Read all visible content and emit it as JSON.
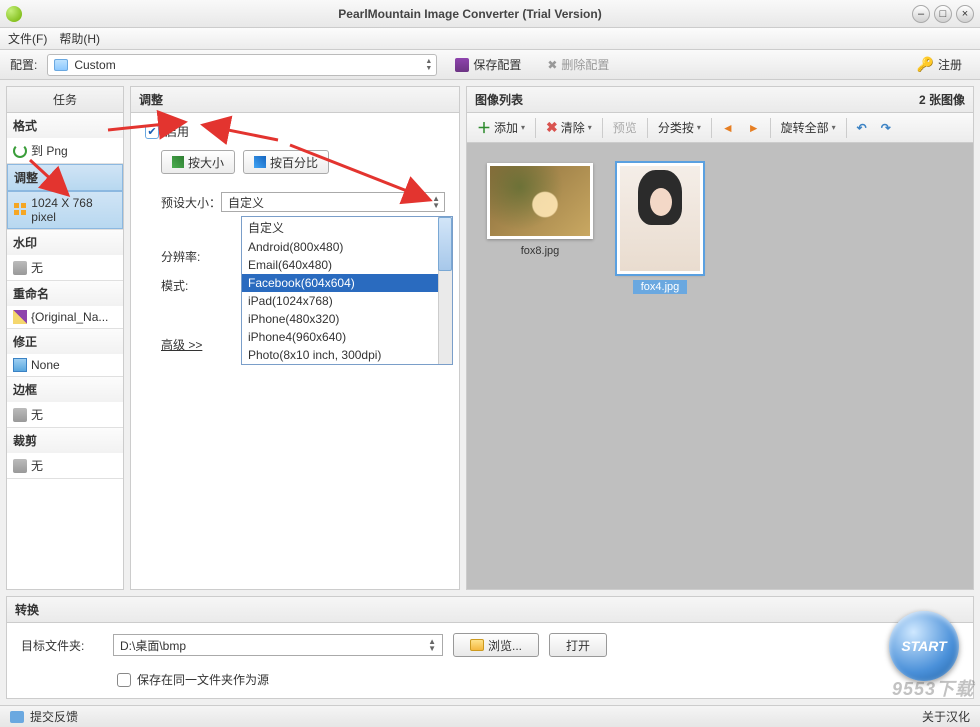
{
  "titlebar": {
    "title": "PearlMountain Image Converter (Trial Version)"
  },
  "menubar": {
    "file": "文件(F)",
    "help": "帮助(H)"
  },
  "toolbar": {
    "config_label": "配置:",
    "config_value": "Custom",
    "save_config": "保存配置",
    "delete_config": "删除配置",
    "register": "注册"
  },
  "sidebar": {
    "header": "任务",
    "sections": [
      {
        "head": "格式",
        "body": "到 Png"
      },
      {
        "head": "调整",
        "body": "1024 X 768 pixel",
        "active": true
      },
      {
        "head": "水印",
        "body": "无"
      },
      {
        "head": "重命名",
        "body": "{Original_Na..."
      },
      {
        "head": "修正",
        "body": "None"
      },
      {
        "head": "边框",
        "body": "无"
      },
      {
        "head": "裁剪",
        "body": "无"
      }
    ]
  },
  "adjust": {
    "header": "调整",
    "enable": "启用",
    "by_size": "按大小",
    "by_percent": "按百分比",
    "preset_label": "预设大小：",
    "preset_value": "自定义",
    "resolution_label": "分辨率:",
    "mode_label": "模式:",
    "advanced": "高级 >>",
    "dropdown": [
      "自定义",
      "Android(800x480)",
      "Email(640x480)",
      "Facebook(604x604)",
      "iPad(1024x768)",
      "iPhone(480x320)",
      "iPhone4(960x640)",
      "Photo(8x10 inch, 300dpi)"
    ],
    "selected_index": 3
  },
  "imagelist": {
    "header": "图像列表",
    "count": "2 张图像",
    "add": "添加",
    "clear": "清除",
    "preview": "预览",
    "sort": "分类按",
    "rotate_all": "旋转全部",
    "items": [
      {
        "name": "fox8.jpg",
        "selected": false
      },
      {
        "name": "fox4.jpg",
        "selected": true
      }
    ]
  },
  "convert": {
    "header": "转换",
    "dest_label": "目标文件夹:",
    "dest_value": "D:\\桌面\\bmp",
    "browse": "浏览...",
    "open": "打开",
    "save_same": "保存在同一文件夹作为源",
    "start": "START"
  },
  "statusbar": {
    "feedback": "提交反馈",
    "about": "关于汉化"
  },
  "watermark": "9553下载"
}
